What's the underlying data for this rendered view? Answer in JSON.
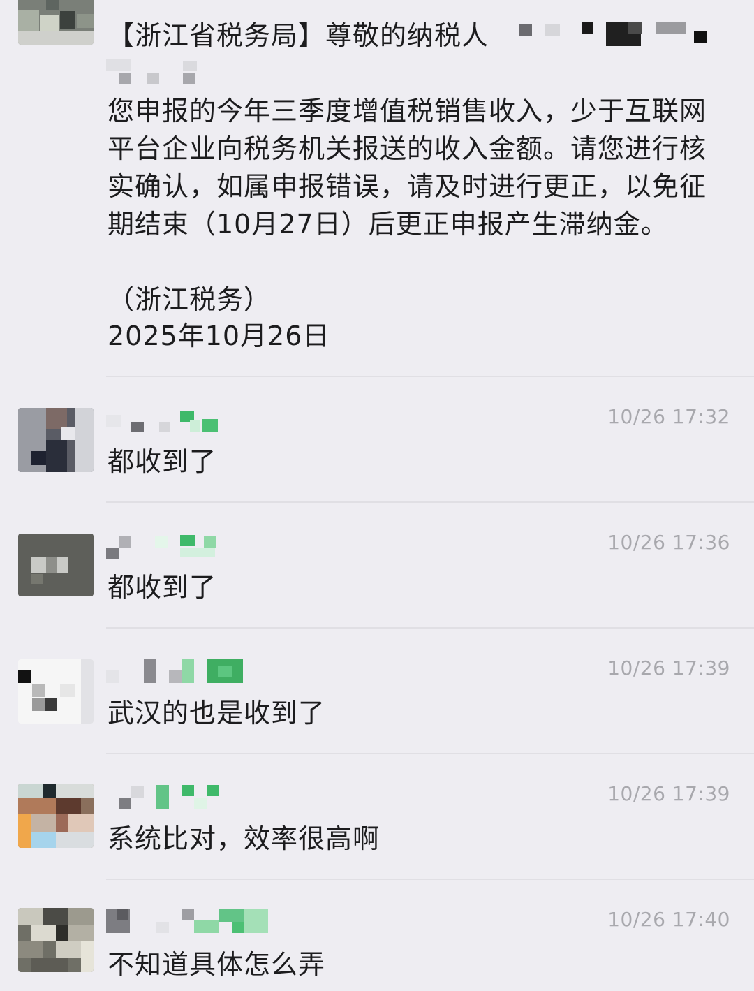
{
  "messages": [
    {
      "title": "【浙江省税务局】尊敬的纳税人",
      "body": "您申报的今年三季度增值税销售收入，少于互联网平台企业向税务机关报送的收入金额。请您进行核实确认，如属申报错误，请及时进行更正，以免征期结束（10月27日）后更正申报产生滞纳金。",
      "signature": "（浙江税务）",
      "date": "2025年10月26日"
    },
    {
      "time": "10/26 17:32",
      "text": "都收到了"
    },
    {
      "time": "10/26 17:36",
      "text": "都收到了"
    },
    {
      "time": "10/26 17:39",
      "text": "武汉的也是收到了"
    },
    {
      "time": "10/26 17:39",
      "text": "系统比对，效率很高啊"
    },
    {
      "time": "10/26 17:40",
      "text": "不知道具体怎么弄"
    }
  ],
  "colors": {
    "background": "#eeedf2",
    "time_text": "#a8a8ad",
    "message_text": "#1c1c1e",
    "mosaic_green": "#3fb96a"
  }
}
